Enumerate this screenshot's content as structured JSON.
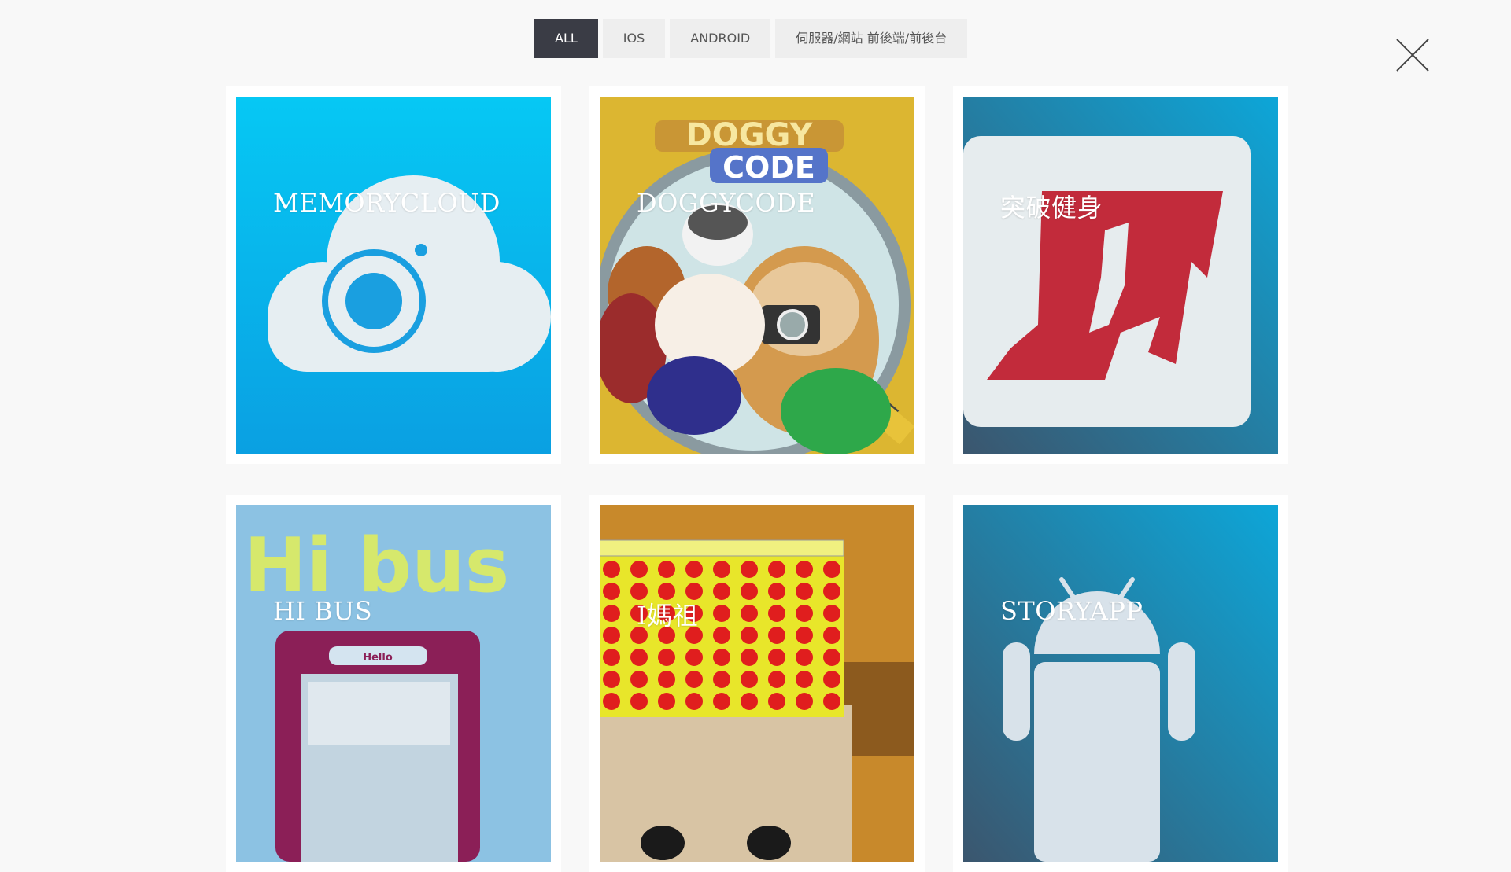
{
  "filters": [
    {
      "label": "ALL",
      "active": true
    },
    {
      "label": "IOS",
      "active": false
    },
    {
      "label": "ANDROID",
      "active": false
    },
    {
      "label": "伺服器/網站 前後端/前後台",
      "active": false
    }
  ],
  "close_icon": "close-x-icon",
  "projects": [
    {
      "title": "MEMORYCLOUD",
      "thumbnail": "memorycloud-app-icon",
      "thumb_text": ""
    },
    {
      "title": "DOGGYCODE",
      "thumbnail": "doggycode-app-icon",
      "thumb_text": "DOGGY CODE"
    },
    {
      "title": "突破健身",
      "thumbnail": "fitness-app-icon",
      "thumb_text": ""
    },
    {
      "title": "HI BUS",
      "thumbnail": "hibus-app-icon",
      "thumb_text": "Hi bus",
      "thumb_sub": "Hello"
    },
    {
      "title": "I媽祖",
      "thumbnail": "imazu-app-icon",
      "thumb_text": ""
    },
    {
      "title": "STORYAPP",
      "thumbnail": "android-app-icon",
      "thumb_text": ""
    }
  ]
}
